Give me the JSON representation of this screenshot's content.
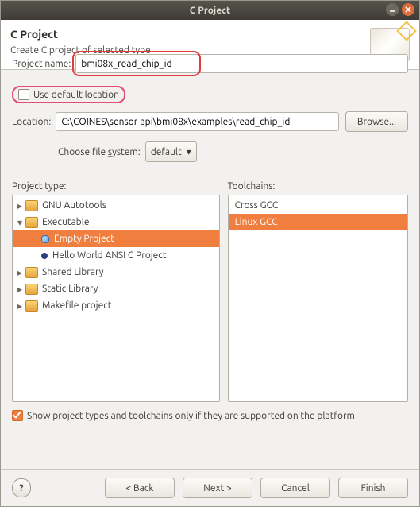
{
  "window": {
    "title": "C Project"
  },
  "header": {
    "title": "C Project",
    "subtitle": "Create C project of selected type"
  },
  "form": {
    "project_name_label": "Project name:",
    "project_name_value": "bmi08x_read_chip_id",
    "use_default_location_label": "Use default location",
    "use_default_location_checked": false,
    "location_label": "Location:",
    "location_value": "C:\\COINES\\sensor-api\\bmi08x\\examples\\read_chip_id",
    "browse_label": "Browse...",
    "choose_fs_label": "Choose file system:",
    "fs_value": "default"
  },
  "ptype": {
    "label": "Project type:",
    "items": [
      {
        "kind": "branch",
        "expanded": false,
        "label": "GNU Autotools"
      },
      {
        "kind": "branch",
        "expanded": true,
        "label": "Executable"
      },
      {
        "kind": "leaf",
        "label": "Empty Project",
        "selected": true,
        "icon": "blue"
      },
      {
        "kind": "leaf",
        "label": "Hello World ANSI C Project",
        "selected": false,
        "icon": "navy"
      },
      {
        "kind": "branch",
        "expanded": false,
        "label": "Shared Library"
      },
      {
        "kind": "branch",
        "expanded": false,
        "label": "Static Library"
      },
      {
        "kind": "branch",
        "expanded": false,
        "label": "Makefile project"
      }
    ]
  },
  "toolchains": {
    "label": "Toolchains:",
    "items": [
      {
        "label": "Cross GCC",
        "selected": false
      },
      {
        "label": "Linux GCC",
        "selected": true
      }
    ]
  },
  "filter": {
    "checked": true,
    "label": "Show project types and toolchains only if they are supported on the platform"
  },
  "footer": {
    "help": "?",
    "back": "< Back",
    "next": "Next >",
    "cancel": "Cancel",
    "finish": "Finish"
  }
}
